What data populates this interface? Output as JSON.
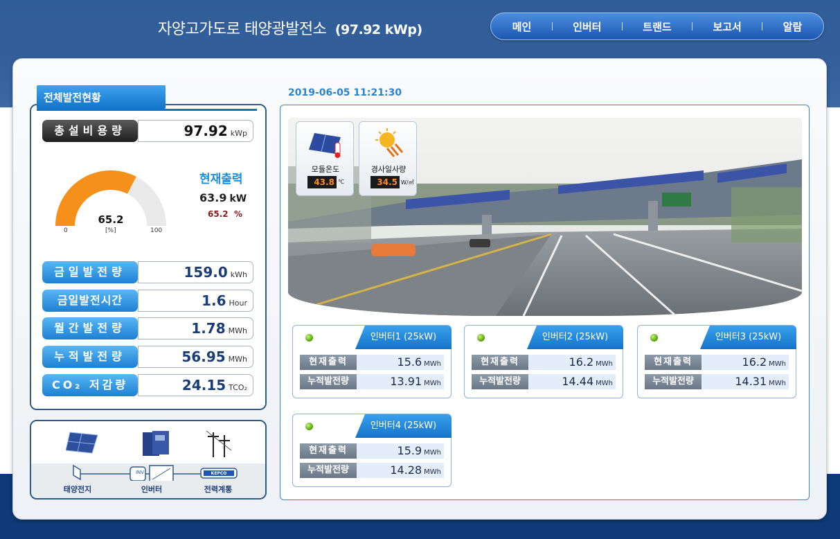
{
  "header": {
    "title": "자양고가도로 태양광발전소",
    "capacity": "(97.92 kWp)",
    "nav": [
      "메인",
      "인버터",
      "트랜드",
      "보고서",
      "알람"
    ]
  },
  "left": {
    "section_title": "전체발전현황",
    "capacity_label": "총설비용량",
    "capacity_value": "97.92",
    "capacity_unit": "kWp",
    "gauge": {
      "value": "65.2",
      "fraction": 0.652,
      "min": "0",
      "max": "100",
      "unit": "[%]"
    },
    "current": {
      "title": "현재출력",
      "kw_value": "63.9",
      "kw_unit": "kW",
      "pct_value": "65.2",
      "pct_unit": "%"
    },
    "stats": [
      {
        "label": "금일발전량",
        "value": "159.0",
        "unit": "kWh"
      },
      {
        "label": "금일발전시간",
        "value": "1.6",
        "unit": "Hour"
      },
      {
        "label": "월간발전량",
        "value": "1.78",
        "unit": "MWh"
      },
      {
        "label": "누적발전량",
        "value": "56.95",
        "unit": "MWh"
      },
      {
        "label": "CO₂ 저감량",
        "value": "24.15",
        "unit": "TCO₂"
      }
    ],
    "flow": [
      "태양전지",
      "인버터",
      "전력계통"
    ],
    "flow_tags": {
      "inv": "INV",
      "kepco": "KEPCO"
    }
  },
  "main": {
    "datetime": "2019-06-05  11:21:30",
    "sensors": [
      {
        "label": "모듈온도",
        "value": "43.8",
        "unit": "℃"
      },
      {
        "label": "경사일사량",
        "value": "34.5",
        "unit": "W/㎡"
      }
    ],
    "inverters": [
      {
        "name": "인버터1 (25kW)",
        "rows": [
          {
            "label": "현재출력",
            "value": "15.6",
            "unit": "MWh"
          },
          {
            "label": "누적발전량",
            "value": "13.91",
            "unit": "MWh"
          }
        ]
      },
      {
        "name": "인버터2 (25kW)",
        "rows": [
          {
            "label": "현재출력",
            "value": "16.2",
            "unit": "MWh"
          },
          {
            "label": "누적발전량",
            "value": "14.44",
            "unit": "MWh"
          }
        ]
      },
      {
        "name": "인버터3 (25kW)",
        "rows": [
          {
            "label": "현재출력",
            "value": "16.2",
            "unit": "MWh"
          },
          {
            "label": "누적발전량",
            "value": "14.31",
            "unit": "MWh"
          }
        ]
      },
      {
        "name": "인버터4 (25kW)",
        "rows": [
          {
            "label": "현재출력",
            "value": "15.9",
            "unit": "MWh"
          },
          {
            "label": "누적발전량",
            "value": "14.28",
            "unit": "MWh"
          }
        ]
      }
    ]
  },
  "colors": {
    "accent_blue": "#1d80d3",
    "gauge_orange": "#f5901a",
    "header_blue": "#2f5d97",
    "footer_navy": "#0e3a78"
  }
}
